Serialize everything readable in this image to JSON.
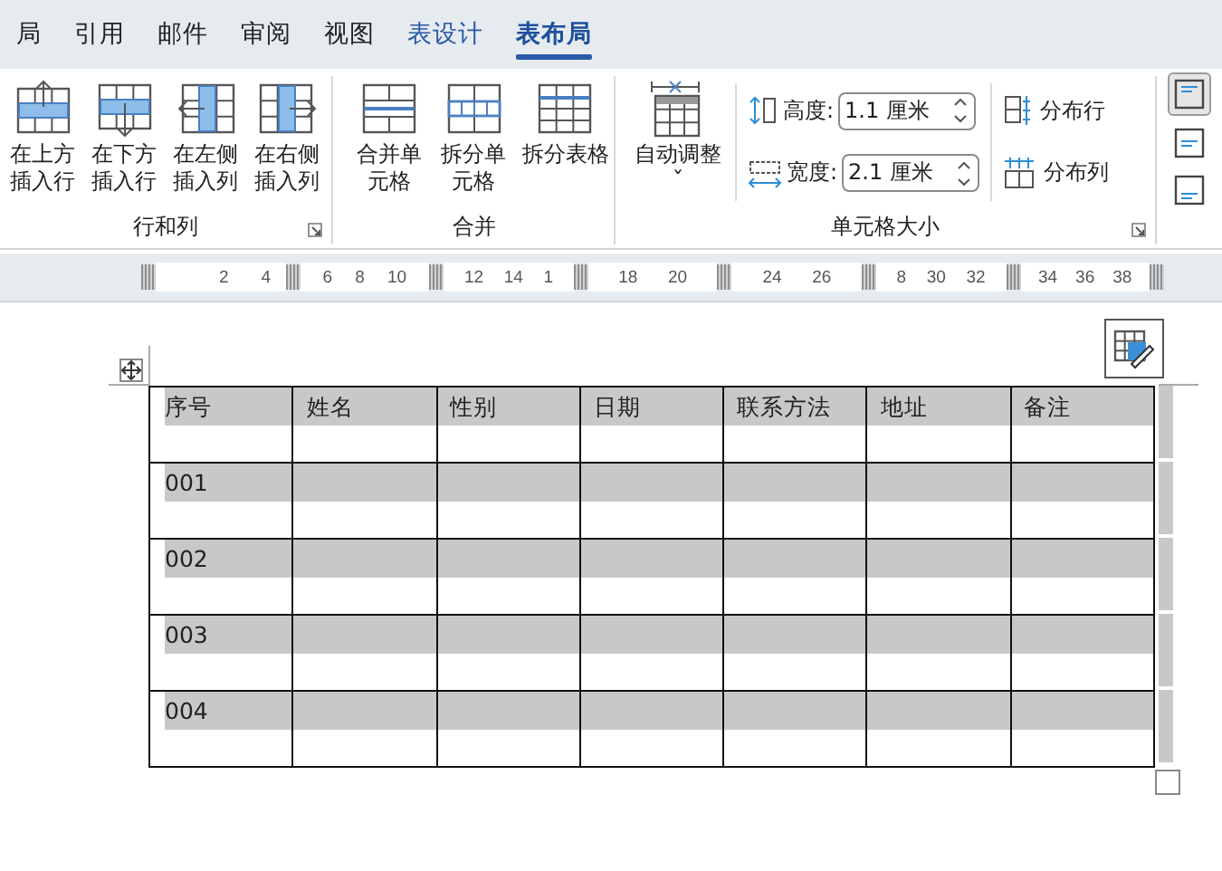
{
  "tabs": [
    {
      "label": "局",
      "contextual": false,
      "selected": false
    },
    {
      "label": "引用",
      "contextual": false,
      "selected": false
    },
    {
      "label": "邮件",
      "contextual": false,
      "selected": false
    },
    {
      "label": "审阅",
      "contextual": false,
      "selected": false
    },
    {
      "label": "视图",
      "contextual": false,
      "selected": false
    },
    {
      "label": "表设计",
      "contextual": true,
      "selected": false
    },
    {
      "label": "表布局",
      "contextual": true,
      "selected": true
    }
  ],
  "ribbon": {
    "groups": [
      {
        "label": "行和列",
        "launcher": true,
        "buttons": [
          {
            "kind": "insert-above",
            "label": "在上方插入行"
          },
          {
            "kind": "insert-below",
            "label": "在下方插入行"
          },
          {
            "kind": "insert-left",
            "label": "在左侧插入列"
          },
          {
            "kind": "insert-right",
            "label": "在右侧插入列"
          }
        ]
      },
      {
        "label": "合并",
        "launcher": false,
        "buttons": [
          {
            "kind": "merge",
            "label": "合并单元格"
          },
          {
            "kind": "split-cells",
            "label": "拆分单元格"
          },
          {
            "kind": "split-table",
            "label": "拆分表格"
          }
        ]
      },
      {
        "label": "单元格大小",
        "launcher": true,
        "autofit": {
          "label": "自动调整",
          "chevron": "ˇ"
        },
        "fields": [
          {
            "kind": "height",
            "label": "高度:",
            "value": "1.1 厘米"
          },
          {
            "kind": "width",
            "label": "宽度:",
            "value": "2.1 厘米"
          }
        ],
        "distribute": [
          {
            "kind": "rows",
            "label": "分布行"
          },
          {
            "kind": "cols",
            "label": "分布列"
          }
        ]
      }
    ],
    "alignment": [
      {
        "kind": "top",
        "selected": true
      },
      {
        "kind": "middle",
        "selected": false
      },
      {
        "kind": "bottom",
        "selected": false
      }
    ]
  },
  "ruler": [
    [
      "2",
      "4"
    ],
    [
      "6",
      "8",
      "10"
    ],
    [
      "12",
      "14",
      "1"
    ],
    [
      "18",
      "20"
    ],
    [
      "24",
      "26"
    ],
    [
      "8",
      "30",
      "32"
    ],
    [
      "34",
      "36",
      "38"
    ]
  ],
  "table": {
    "columns": [
      "序号",
      "姓名",
      "性别",
      "日期",
      "联系方法",
      "地址",
      "备注"
    ],
    "rows": [
      [
        "001"
      ],
      [
        "002"
      ],
      [
        "003"
      ],
      [
        "004"
      ]
    ]
  }
}
